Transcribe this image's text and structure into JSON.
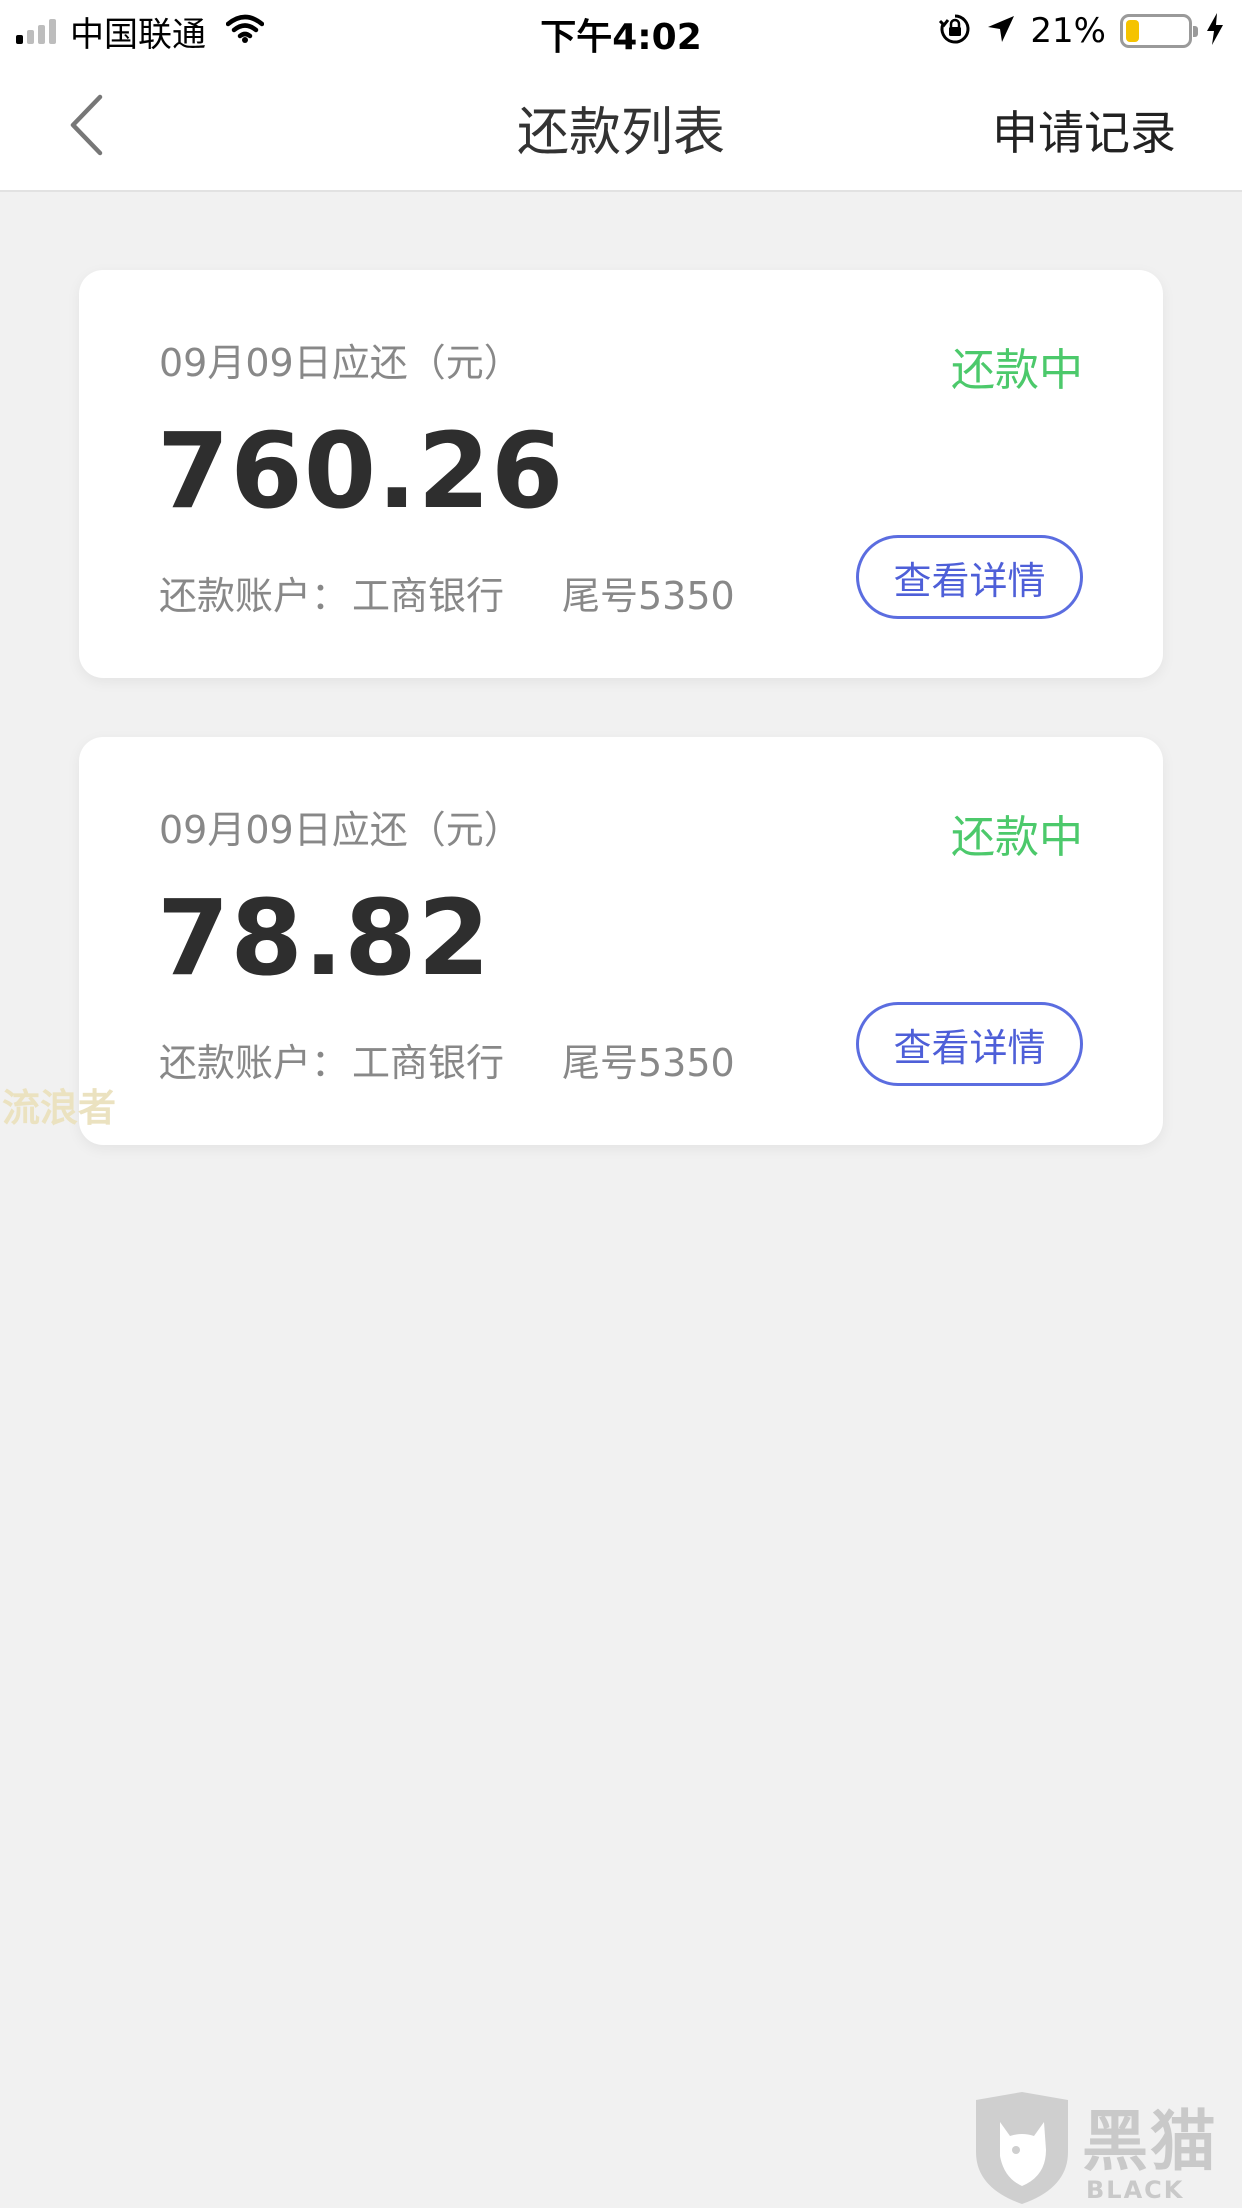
{
  "status_bar": {
    "carrier": "中国联通",
    "time": "下午4:02",
    "battery_percent": "21%",
    "battery_level": 0.21,
    "signal_bars_active": 1,
    "icons": [
      "signal-icon",
      "wifi-icon",
      "orientation-lock-icon",
      "location-icon",
      "battery-icon",
      "charging-icon"
    ]
  },
  "nav": {
    "back_icon": "chevron-left-icon",
    "title": "还款列表",
    "action": "申请记录"
  },
  "colors": {
    "status_green": "#4cc96b",
    "button_blue": "#4e5fd8",
    "background": "#f1f1f1",
    "amount_text": "#2e2e2e"
  },
  "repayments": [
    {
      "due_label": "09月09日应还（元）",
      "status": "还款中",
      "amount": "760.26",
      "account_label": "还款账户：",
      "bank": "工商银行",
      "tail": "尾号5350",
      "button": "查看详情"
    },
    {
      "due_label": "09月09日应还（元）",
      "status": "还款中",
      "amount": "78.82",
      "account_label": "还款账户：",
      "bank": "工商银行",
      "tail": "尾号5350",
      "button": "查看详情"
    }
  ],
  "watermarks": {
    "left": "流浪者",
    "logo_cn": "黑猫",
    "logo_en": "BLACK CAT"
  }
}
